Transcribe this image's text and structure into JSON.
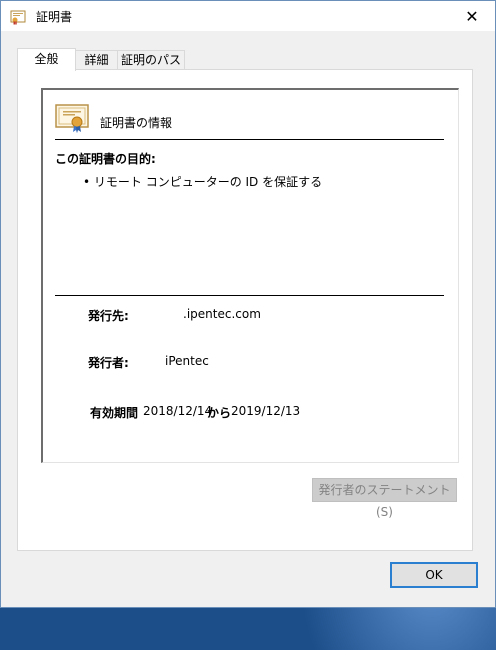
{
  "window": {
    "title": "証明書",
    "close_glyph": "✕"
  },
  "tabs": [
    {
      "label": "全般",
      "active": true
    },
    {
      "label": "詳細",
      "active": false
    },
    {
      "label": "証明のパス",
      "active": false
    }
  ],
  "certificate": {
    "info_title": "証明書の情報",
    "purpose_heading": "この証明書の目的:",
    "purpose_items": [
      "• リモート コンピューターの ID を保証する"
    ],
    "issued_to_label": "発行先:",
    "issued_to_value": ".ipentec.com",
    "issued_by_label": "発行者:",
    "issued_by_value": "iPentec",
    "validity_label": "有効期間",
    "valid_from": "2018/12/14",
    "valid_from_to_word": "から",
    "valid_to": "2019/12/13"
  },
  "buttons": {
    "issuer_statement": "発行者のステートメント(S)",
    "ok": "OK"
  },
  "colors": {
    "accent_border": "#2a7fd1",
    "disabled_text": "#838383",
    "cert_ribbon": "#e2a33a"
  },
  "icons": {
    "title": "certificate-icon",
    "close": "close-icon",
    "cert": "certificate-icon"
  }
}
